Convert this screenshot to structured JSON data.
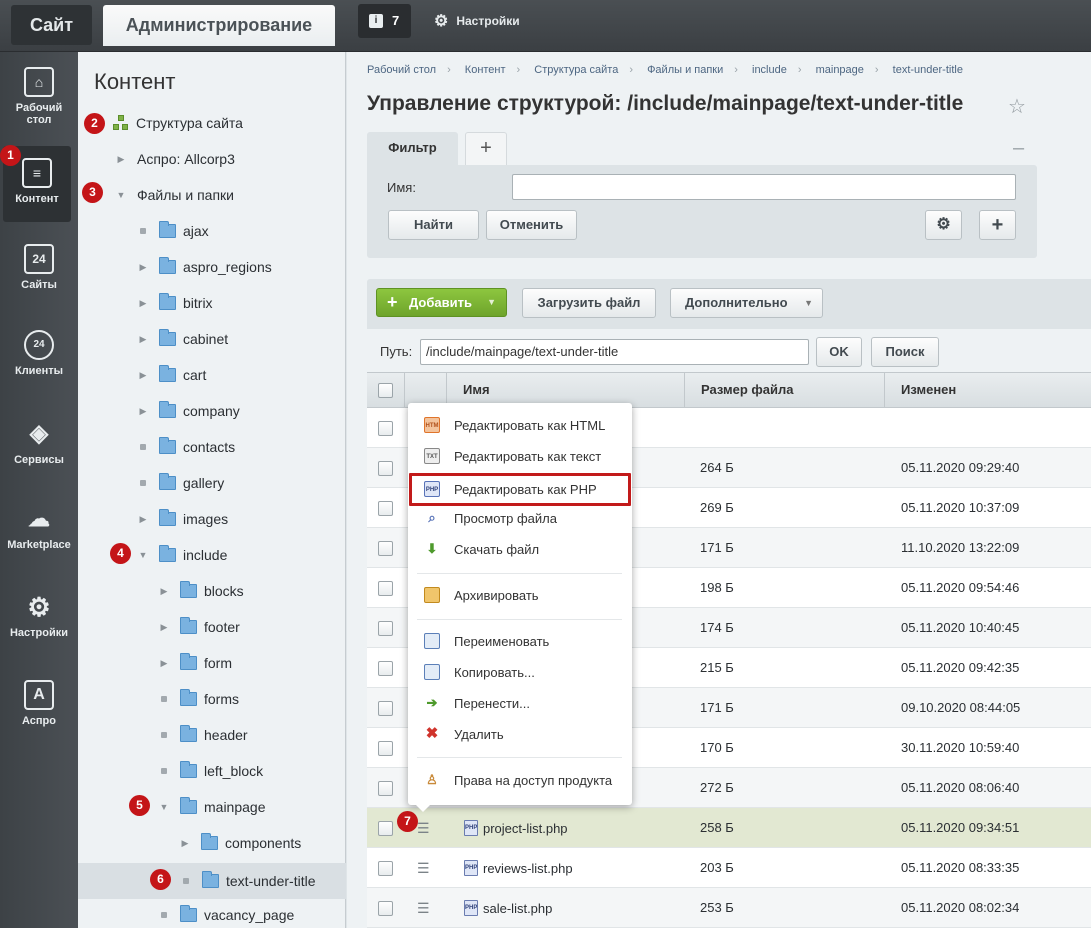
{
  "topbar": {
    "site_tab": "Сайт",
    "admin_tab": "Администрирование",
    "notifications_count": "7",
    "settings_label": "Настройки"
  },
  "leftnav": {
    "items": [
      {
        "label": "Рабочий стол",
        "icon": "home-icon"
      },
      {
        "label": "Контент",
        "icon": "document-icon"
      },
      {
        "label": "Сайты",
        "icon": "calendar-24-icon"
      },
      {
        "label": "Клиенты",
        "icon": "crm-24-icon"
      },
      {
        "label": "Сервисы",
        "icon": "layers-icon"
      },
      {
        "label": "Marketplace",
        "icon": "cloud-download-icon"
      },
      {
        "label": "Настройки",
        "icon": "gear-icon"
      },
      {
        "label": "Аспро",
        "icon": "letter-a-icon"
      }
    ]
  },
  "badges": [
    "1",
    "2",
    "3",
    "4",
    "5",
    "6",
    "7"
  ],
  "tree": {
    "title": "Контент",
    "site_structure": "Структура сайта",
    "aspro": "Аспро: Allcorp3",
    "files_folders": "Файлы и папки",
    "folders": [
      "ajax",
      "aspro_regions",
      "bitrix",
      "cabinet",
      "cart",
      "company",
      "contacts",
      "gallery",
      "images",
      "include"
    ],
    "include_children": [
      "blocks",
      "footer",
      "form",
      "forms",
      "header",
      "left_block",
      "mainpage"
    ],
    "mainpage_children": [
      "components",
      "text-under-title"
    ],
    "after": [
      "vacancy_page"
    ]
  },
  "breadcrumbs": [
    "Рабочий стол",
    "Контент",
    "Структура сайта",
    "Файлы и папки",
    "include",
    "mainpage",
    "text-under-title"
  ],
  "page_title": "Управление структурой: /include/mainpage/text-under-title",
  "filter": {
    "tab": "Фильтр",
    "name_label": "Имя:",
    "name_value": "",
    "find": "Найти",
    "cancel": "Отменить"
  },
  "toolbar": {
    "add": "Добавить",
    "upload": "Загрузить файл",
    "more": "Дополнительно"
  },
  "path": {
    "label": "Путь:",
    "value": "/include/mainpage/text-under-title",
    "ok": "OK",
    "search": "Поиск"
  },
  "table": {
    "headers": [
      "Имя",
      "Размер файла",
      "Изменен"
    ],
    "rows": [
      {
        "name": "",
        "size": "",
        "date": ""
      },
      {
        "name": "",
        "size": "264 Б",
        "date": "05.11.2020 09:29:40"
      },
      {
        "name": "",
        "size": "269 Б",
        "date": "05.11.2020 10:37:09"
      },
      {
        "name": "",
        "size": "171 Б",
        "date": "11.10.2020 13:22:09"
      },
      {
        "name": "",
        "size": "198 Б",
        "date": "05.11.2020 09:54:46"
      },
      {
        "name": "",
        "size": "174 Б",
        "date": "05.11.2020 10:40:45"
      },
      {
        "name": "",
        "size": "215 Б",
        "date": "05.11.2020 09:42:35"
      },
      {
        "name": "",
        "size": "171 Б",
        "date": "09.10.2020 08:44:05"
      },
      {
        "name": "",
        "size": "170 Б",
        "date": "30.11.2020 10:59:40"
      },
      {
        "name": "",
        "size": "272 Б",
        "date": "05.11.2020 08:06:40"
      },
      {
        "name": "project-list.php",
        "size": "258 Б",
        "date": "05.11.2020 09:34:51"
      },
      {
        "name": "reviews-list.php",
        "size": "203 Б",
        "date": "05.11.2020 08:33:35"
      },
      {
        "name": "sale-list.php",
        "size": "253 Б",
        "date": "05.11.2020 08:02:34"
      }
    ]
  },
  "context_menu": {
    "items": [
      {
        "label": "Редактировать как HTML",
        "icon": "html-file-icon",
        "color": "#e0742a"
      },
      {
        "label": "Редактировать как текст",
        "icon": "txt-file-icon",
        "color": "#6b6b6b"
      },
      {
        "label": "Редактировать как PHP",
        "icon": "php-file-icon",
        "color": "#5873b8"
      },
      {
        "label": "Просмотр файла",
        "icon": "magnifier-icon",
        "color": "#5873b8"
      },
      {
        "label": "Скачать файл",
        "icon": "download-icon",
        "color": "#4e9a2c"
      },
      {
        "label": "Архивировать",
        "icon": "archive-icon",
        "color": "#d99a2e"
      },
      {
        "label": "Переименовать",
        "icon": "rename-icon",
        "color": "#5b7fb8"
      },
      {
        "label": "Копировать...",
        "icon": "copy-icon",
        "color": "#5b7fb8"
      },
      {
        "label": "Перенести...",
        "icon": "move-icon",
        "color": "#4e9a2c"
      },
      {
        "label": "Удалить",
        "icon": "delete-icon",
        "color": "#d0342c"
      },
      {
        "label": "Права на доступ продукта",
        "icon": "access-rights-icon",
        "color": "#c98a3a"
      }
    ],
    "highlight_color": "#c21a1a"
  }
}
